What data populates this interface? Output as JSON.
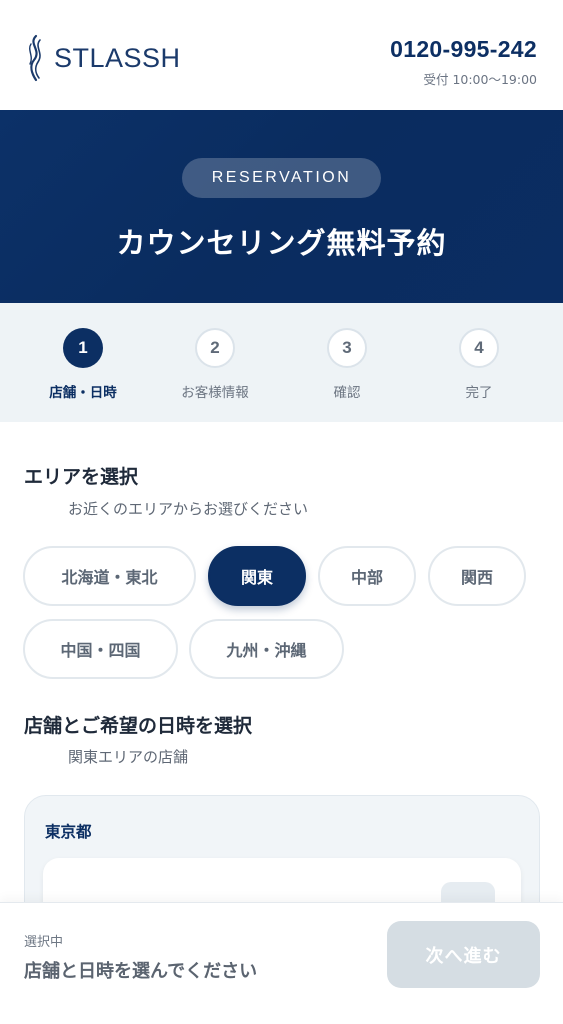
{
  "header": {
    "brand": "STLASSH",
    "phone_number": "0120-995-242",
    "hours": "受付 10:00〜19:00"
  },
  "hero": {
    "badge": "RESERVATION",
    "title": "カウンセリング無料予約"
  },
  "steps": [
    {
      "number": "1",
      "label": "店舗・日時",
      "active": true
    },
    {
      "number": "2",
      "label": "お客様情報",
      "active": false
    },
    {
      "number": "3",
      "label": "確認",
      "active": false
    },
    {
      "number": "4",
      "label": "完了",
      "active": false
    }
  ],
  "area": {
    "title": "エリアを選択",
    "subtitle": "お近くのエリアからお選びください",
    "options": [
      "北海道・東北",
      "関東",
      "中部",
      "関西",
      "中国・四国",
      "九州・沖縄"
    ],
    "selected": "関東"
  },
  "store": {
    "title": "店舗とご希望の日時を選択",
    "subtitle": "関東エリアの店舗",
    "prefecture": "東京都"
  },
  "bottom": {
    "caption": "選択中",
    "value": "店舗と日時を選んでください",
    "next_label": "次へ進む"
  },
  "colors": {
    "primary": "#0c2f63",
    "steps_bg": "#eef3f6",
    "disabled_button": "#d5dde3"
  }
}
